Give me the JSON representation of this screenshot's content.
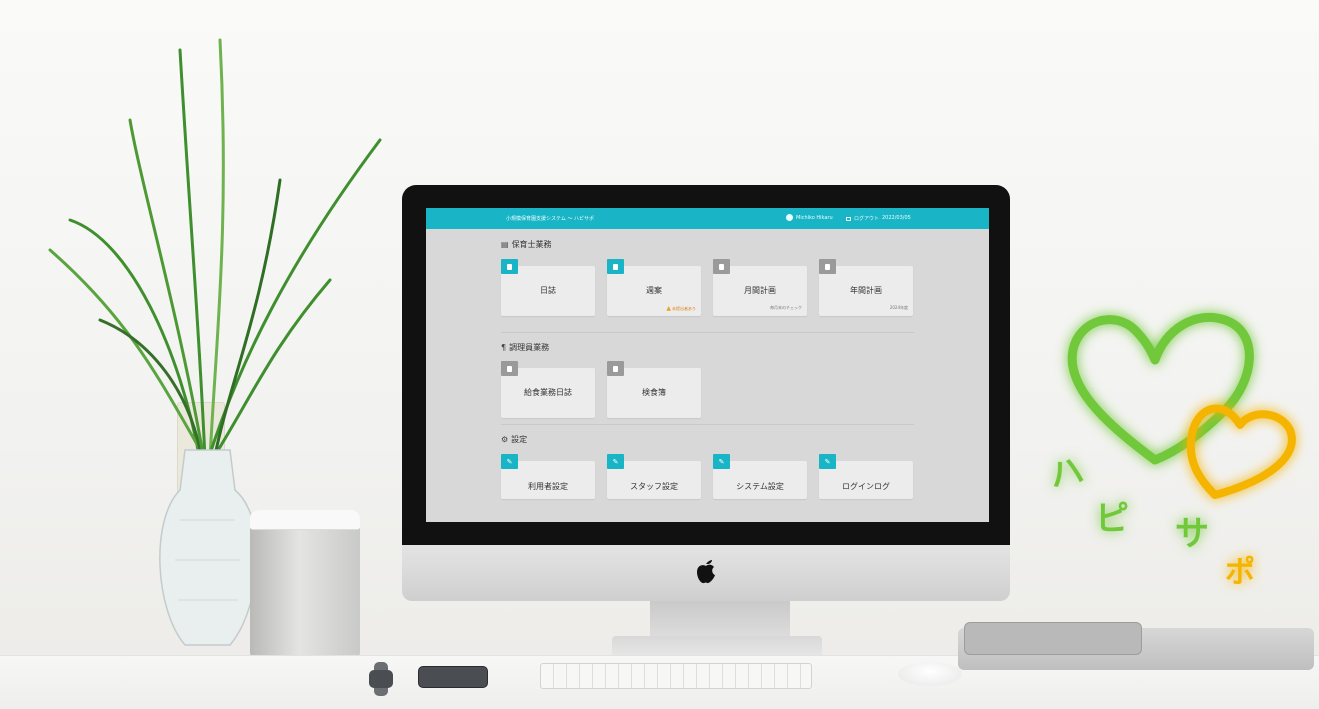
{
  "app": {
    "title": "小規模保育園支援システム ～ ハピサポ",
    "user": "Michiko Hikaru",
    "logout_label": "ログアウト",
    "date": "2022/03/05"
  },
  "sections": [
    {
      "title": "保育士業務",
      "icon": "newspaper-icon",
      "tiles": [
        {
          "label": "日誌",
          "badge_color": "#19b4c6",
          "sub": ""
        },
        {
          "label": "週案",
          "badge_color": "#19b4c6",
          "warning": "未提出者あり"
        },
        {
          "label": "月間計画",
          "badge_color": "#9a9a9a",
          "sub": "毎月末のチェック"
        },
        {
          "label": "年間計画",
          "badge_color": "#9a9a9a",
          "sub": "2024年度"
        }
      ]
    },
    {
      "title": "調理員業務",
      "icon": "utensils-icon",
      "tiles": [
        {
          "label": "給食業務日誌",
          "badge_color": "#9a9a9a"
        },
        {
          "label": "検食簿",
          "badge_color": "#9a9a9a"
        }
      ]
    },
    {
      "title": "設定",
      "icon": "gears-icon",
      "tiles": [
        {
          "label": "利用者設定",
          "badge_color": "#19b4c6"
        },
        {
          "label": "スタッフ設定",
          "badge_color": "#19b4c6"
        },
        {
          "label": "システム設定",
          "badge_color": "#19b4c6"
        },
        {
          "label": "ログインログ",
          "badge_color": "#19b4c6"
        }
      ]
    }
  ],
  "logo": {
    "chars": [
      "ハ",
      "ピ",
      "サ",
      "ポ"
    ],
    "heart_green": "#72c83a",
    "heart_orange": "#f4b400"
  },
  "colors": {
    "accent": "#19b4c6"
  }
}
